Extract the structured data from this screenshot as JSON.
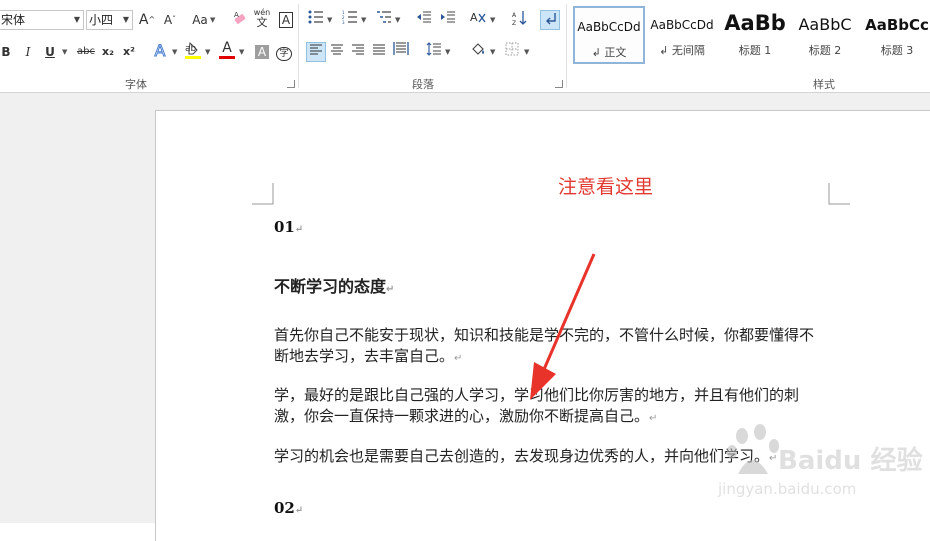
{
  "ribbon": {
    "font_group": {
      "label": "字体",
      "font_name": "宋体",
      "font_size": "小四",
      "grow_label": "A",
      "shrink_label": "A",
      "case_label": "Aa",
      "bold": "B",
      "italic": "I",
      "underline": "U",
      "strike": "abc",
      "subscript": "x₂",
      "superscript": "x²",
      "phonetic": "wén",
      "phonetic_char": "文",
      "border_char": "A",
      "text_effect": "A",
      "font_color": "A",
      "char_shading": "A",
      "enclose": "字"
    },
    "paragraph_group": {
      "label": "段落"
    },
    "styles_group": {
      "label": "样式",
      "items": [
        {
          "sample": "AaBbCcDd",
          "name": "↲ 正文"
        },
        {
          "sample": "AaBbCcDd",
          "name": "↲ 无间隔"
        },
        {
          "sample": "AaBb",
          "name": "标题 1"
        },
        {
          "sample": "AaBbC",
          "name": "标题 2"
        },
        {
          "sample": "AaBbCc",
          "name": "标题 3"
        }
      ]
    }
  },
  "document": {
    "annotation": "注意看这里",
    "heading1": "01",
    "section_title": "不断学习的态度",
    "para1": "首先你自己不能安于现状，知识和技能是学不完的，不管什么时候，你都要懂得不断地去学习，去丰富自己。",
    "para2": "学，最好的是跟比自己强的人学习，学习他们比你厉害的地方，并且有他们的刺激，你会一直保持一颗求进的心，激励你不断提高自己。",
    "para3": "学习的机会也是需要自己去创造的，去发现身边优秀的人，并向他们学习。",
    "heading2": "02",
    "para_mark": "↵"
  },
  "watermark": {
    "text": "Baidu 经验",
    "url": "jingyan.baidu.com"
  },
  "colors": {
    "annotation": "#e23a30",
    "highlight": "#ffff00",
    "font_color_bar": "#e00000",
    "arrow": "#e8332a"
  }
}
